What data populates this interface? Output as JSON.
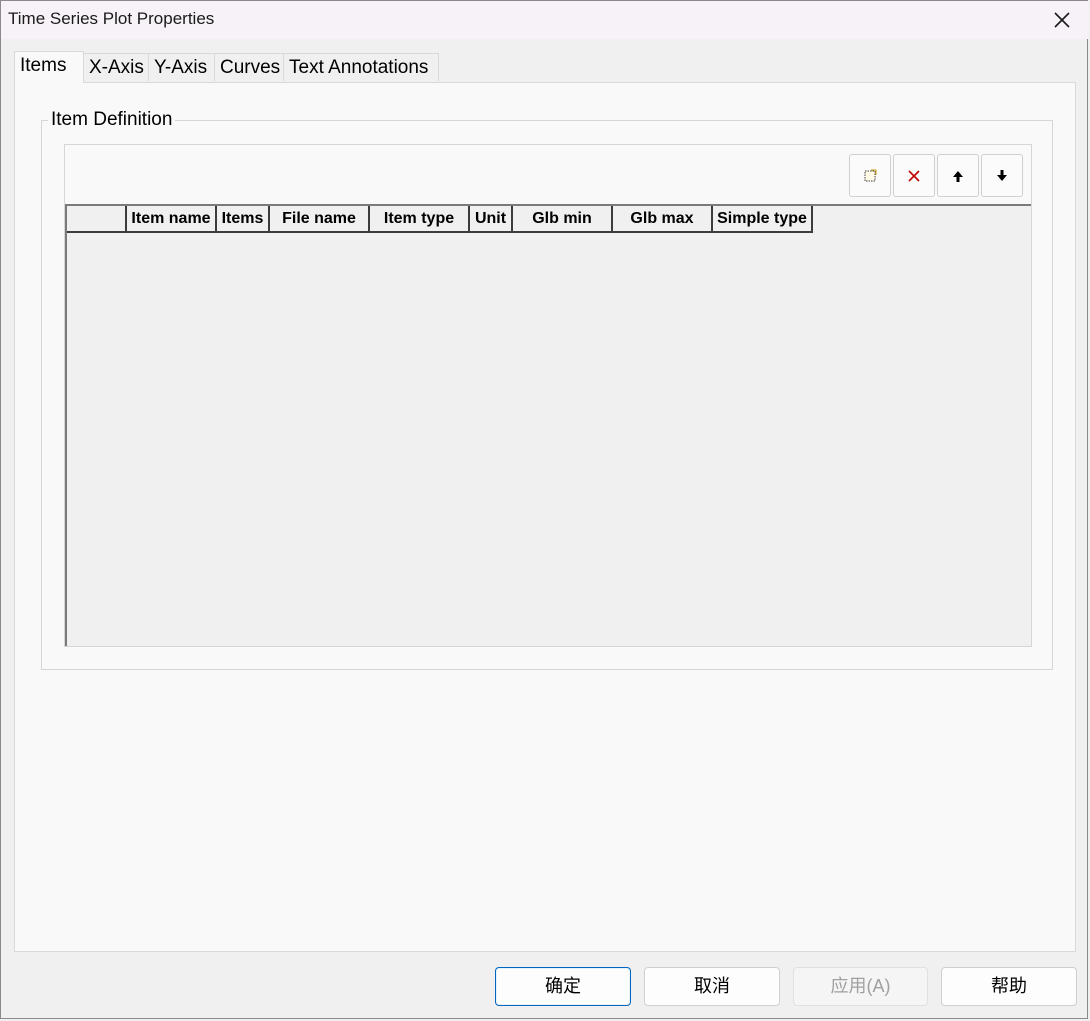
{
  "window": {
    "title": "Time Series Plot Properties"
  },
  "tabs": [
    {
      "label": "Items",
      "active": true
    },
    {
      "label": "X-Axis"
    },
    {
      "label": "Y-Axis"
    },
    {
      "label": "Curves"
    },
    {
      "label": "Text Annotations"
    }
  ],
  "group": {
    "label": "Item Definition"
  },
  "toolbar": {
    "buttons": [
      {
        "icon": "new-item-icon"
      },
      {
        "icon": "delete-x-icon",
        "color": "#c00000"
      },
      {
        "icon": "arrow-up-icon"
      },
      {
        "icon": "arrow-down-icon"
      }
    ]
  },
  "grid": {
    "columns": [
      "",
      "Item name",
      "Items",
      "File name",
      "Item type",
      "Unit",
      "Glb min",
      "Glb max",
      "Simple type"
    ],
    "rows": []
  },
  "buttons": {
    "ok": "确定",
    "cancel": "取消",
    "apply": "应用(A)",
    "help": "帮助"
  },
  "colors": {
    "accent": "#0067c0"
  }
}
